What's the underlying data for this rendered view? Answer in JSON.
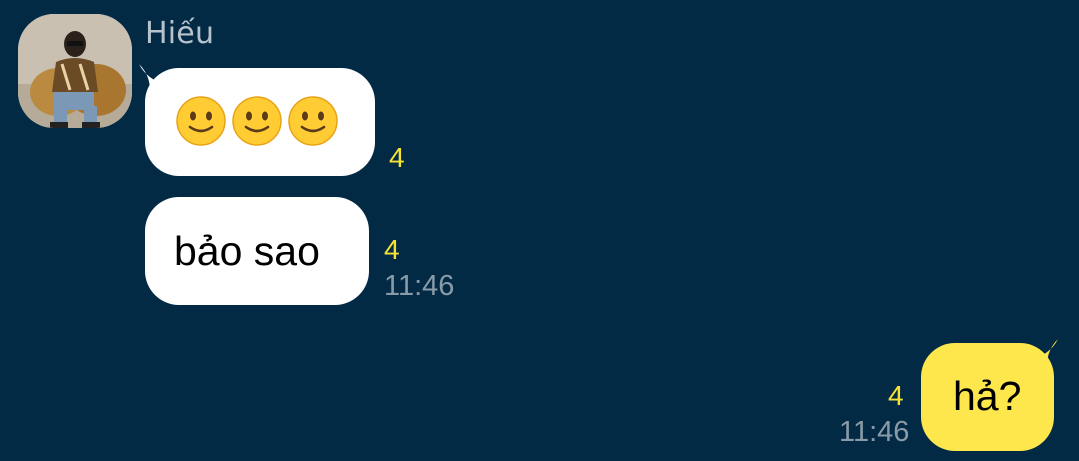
{
  "conversation": {
    "sender_name": "Hiếu",
    "messages": [
      {
        "side": "incoming",
        "content": "🙂🙂🙂",
        "read_count": "4"
      },
      {
        "side": "incoming",
        "content": "bảo sao",
        "read_count": "4",
        "time": "11:46"
      },
      {
        "side": "outgoing",
        "content": "hả?",
        "read_count": "4",
        "time": "11:46"
      }
    ]
  },
  "icons": {
    "emoji": "slightly-smiling-face-icon"
  },
  "colors": {
    "background": "#032a45",
    "incoming_bubble": "#ffffff",
    "outgoing_bubble": "#fde74c",
    "read_count": "#f6e232",
    "timestamp": "#8a9ba8",
    "sender_name": "#b7c3cc"
  }
}
